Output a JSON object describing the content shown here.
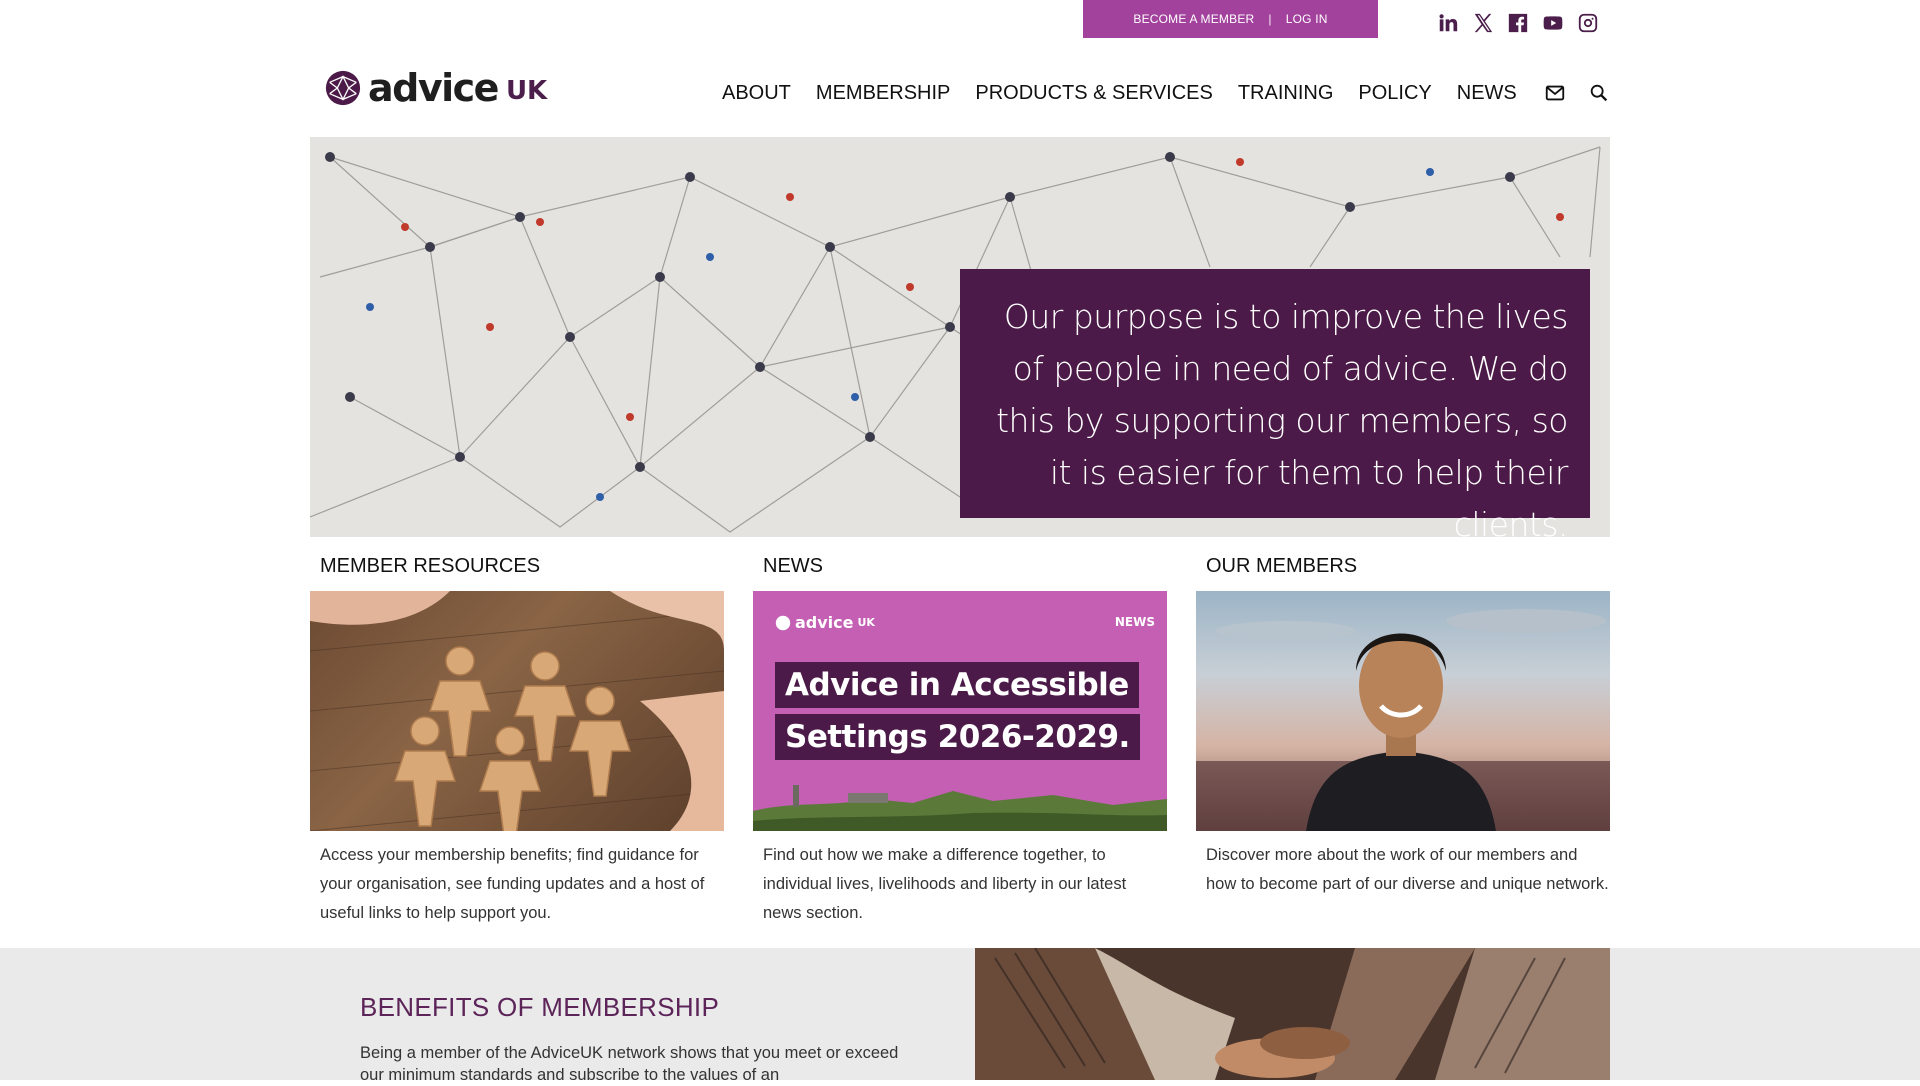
{
  "topbar": {
    "become_member": "BECOME A MEMBER",
    "separator": "|",
    "login": "LOG IN",
    "bg_color": "#a2429d"
  },
  "socials": [
    {
      "icon": "linkedin-icon"
    },
    {
      "icon": "x-twitter-icon"
    },
    {
      "icon": "facebook-icon"
    },
    {
      "icon": "youtube-icon"
    },
    {
      "icon": "instagram-icon"
    }
  ],
  "logo": {
    "word": "advice",
    "suffix": "UK"
  },
  "nav": {
    "items": [
      "ABOUT",
      "MEMBERSHIP",
      "PRODUCTS & SERVICES",
      "TRAINING",
      "POLICY",
      "NEWS"
    ],
    "icons": [
      "mail-icon",
      "search-icon"
    ]
  },
  "hero": {
    "text": "Our purpose is to improve the lives of people in need of advice. We do this by supporting our members, so it is easier for them to help their clients.",
    "box_color": "#4c1a48"
  },
  "cards": [
    {
      "title": "MEMBER RESOURCES",
      "text": "Access your membership benefits; find guidance for your organisation, see funding updates and a host of useful links to help support you."
    },
    {
      "title": "NEWS",
      "text": "Find out how we make a difference together, to individual lives, livelihoods and liberty in our latest news section.",
      "image": {
        "brand": "advice",
        "brand_suffix": "UK",
        "tag": "NEWS",
        "line1": "Advice in Accessible",
        "line2": "Settings 2026-2029."
      }
    },
    {
      "title": "OUR MEMBERS",
      "text": "Discover more about the work of our members and how to become part of our diverse and unique network."
    }
  ],
  "benefits": {
    "title": "BENEFITS OF MEMBERSHIP",
    "text": "Being a member of the AdviceUK network shows that you meet or exceed our minimum standards and subscribe to the values of an"
  },
  "colors": {
    "brand_purple": "#4c1a48",
    "accent_pink": "#a2429d",
    "heading_purple": "#5c2459"
  }
}
